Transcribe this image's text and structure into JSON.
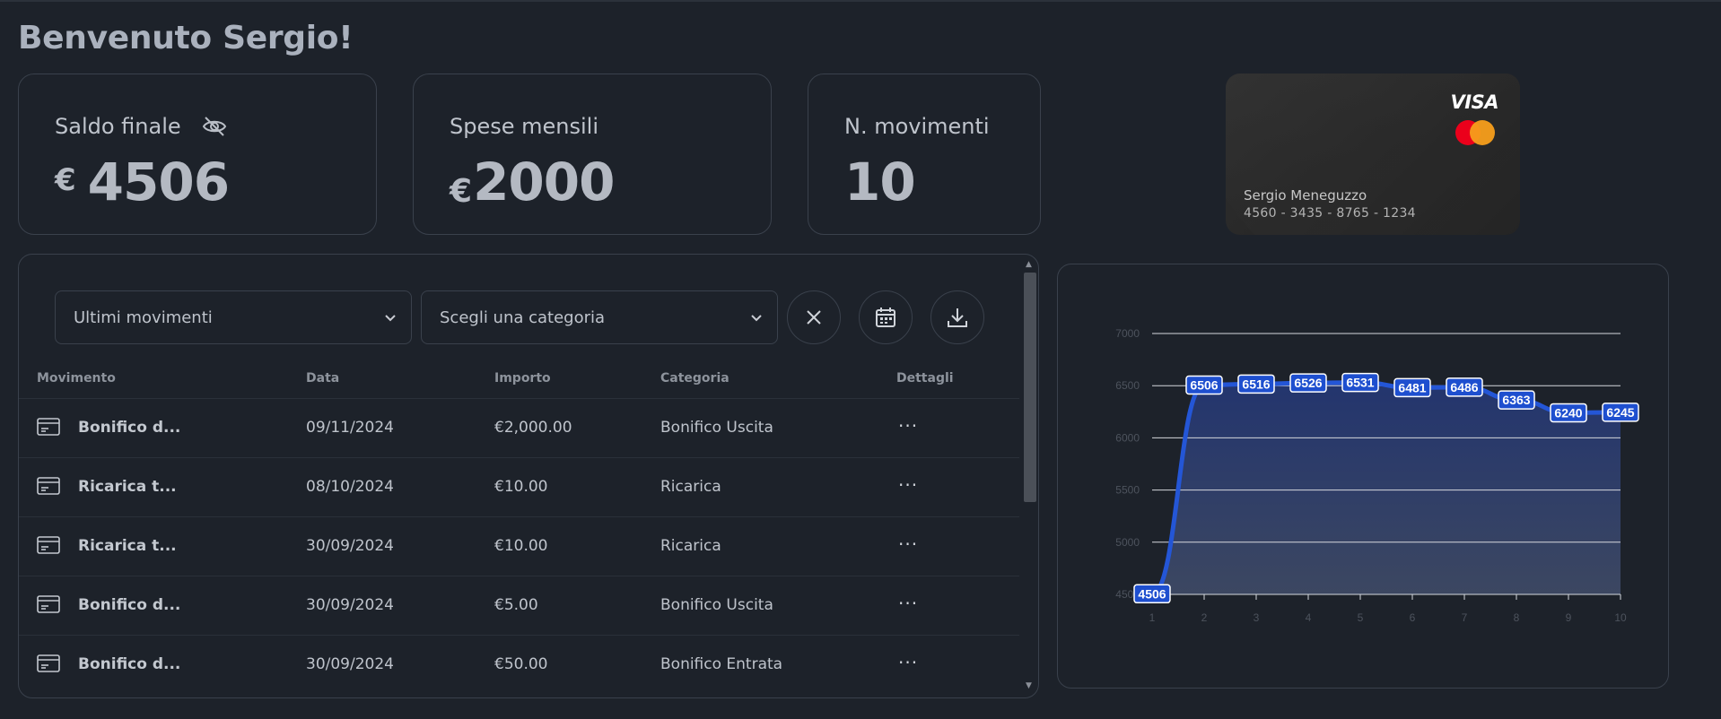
{
  "greeting": "Benvenuto Sergio!",
  "stats": {
    "balance": {
      "label": "Saldo finale",
      "currency": "€",
      "value": "4506"
    },
    "monthly": {
      "label": "Spese mensili",
      "currency": "€",
      "value": "2000"
    },
    "count": {
      "label": "N. movimenti",
      "value": "10"
    }
  },
  "card": {
    "brand": "VISA",
    "holder": "Sergio Meneguzzo",
    "number": "4560 - 3435 - 8765 - 1234"
  },
  "filters": {
    "period": "Ultimi movimenti",
    "category": "Scegli una categoria"
  },
  "table": {
    "headers": [
      "Movimento",
      "Data",
      "Importo",
      "Categoria",
      "Dettagli"
    ],
    "rows": [
      {
        "movimento": "Bonifico d...",
        "data": "09/11/2024",
        "importo": "€2,000.00",
        "categoria": "Bonifico Uscita",
        "dettagli": "···"
      },
      {
        "movimento": "Ricarica t...",
        "data": "08/10/2024",
        "importo": "€10.00",
        "categoria": "Ricarica",
        "dettagli": "···"
      },
      {
        "movimento": "Ricarica t...",
        "data": "30/09/2024",
        "importo": "€10.00",
        "categoria": "Ricarica",
        "dettagli": "···"
      },
      {
        "movimento": "Bonifico d...",
        "data": "30/09/2024",
        "importo": "€5.00",
        "categoria": "Bonifico Uscita",
        "dettagli": "···"
      },
      {
        "movimento": "Bonifico d...",
        "data": "30/09/2024",
        "importo": "€50.00",
        "categoria": "Bonifico Entrata",
        "dettagli": "···"
      }
    ]
  },
  "chart_data": {
    "type": "area",
    "x": [
      1,
      2,
      3,
      4,
      5,
      6,
      7,
      8,
      9,
      10
    ],
    "series": [
      {
        "values": [
          4506,
          6506,
          6516,
          6526,
          6531,
          6481,
          6486,
          6363,
          6240,
          6245
        ]
      }
    ],
    "data_labels": [
      "4506",
      "6506",
      "6516",
      "6526",
      "6531",
      "6481",
      "6486",
      "6363",
      "6240",
      "6245"
    ],
    "y_ticks": [
      4500,
      5000,
      5500,
      6000,
      6500,
      7000
    ],
    "x_ticks": [
      1,
      2,
      3,
      4,
      5,
      6,
      7,
      8,
      9,
      10
    ],
    "ylim": [
      4500,
      7000
    ],
    "grid": true,
    "colors": {
      "line": "#2456d6",
      "fill_top": "#23356e",
      "fill_bottom": "#3c4761",
      "label_bg": "#1e4fcf"
    }
  }
}
